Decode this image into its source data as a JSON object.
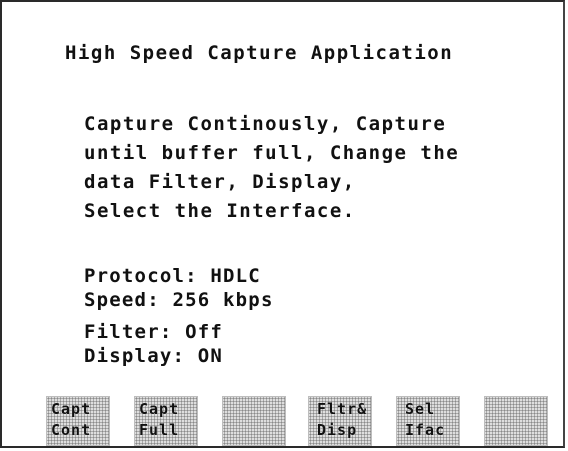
{
  "app": {
    "title": "High Speed Capture Application"
  },
  "description": {
    "lines": [
      "Capture Continously, Capture",
      "until buffer full, Change the",
      "data Filter, Display,",
      "Select the Interface."
    ]
  },
  "status": {
    "protocol": "Protocol: HDLC",
    "speed": "Speed: 256 kbps",
    "filter": "Filter: Off",
    "display": "Display: ON"
  },
  "softkeys": [
    {
      "line1": "Capt",
      "line2": "Cont"
    },
    {
      "line1": "Capt",
      "line2": "Full"
    },
    {
      "line1": "",
      "line2": ""
    },
    {
      "line1": "Fltr&",
      "line2": "Disp"
    },
    {
      "line1": "Sel",
      "line2": "Ifac"
    },
    {
      "line1": "",
      "line2": ""
    }
  ]
}
